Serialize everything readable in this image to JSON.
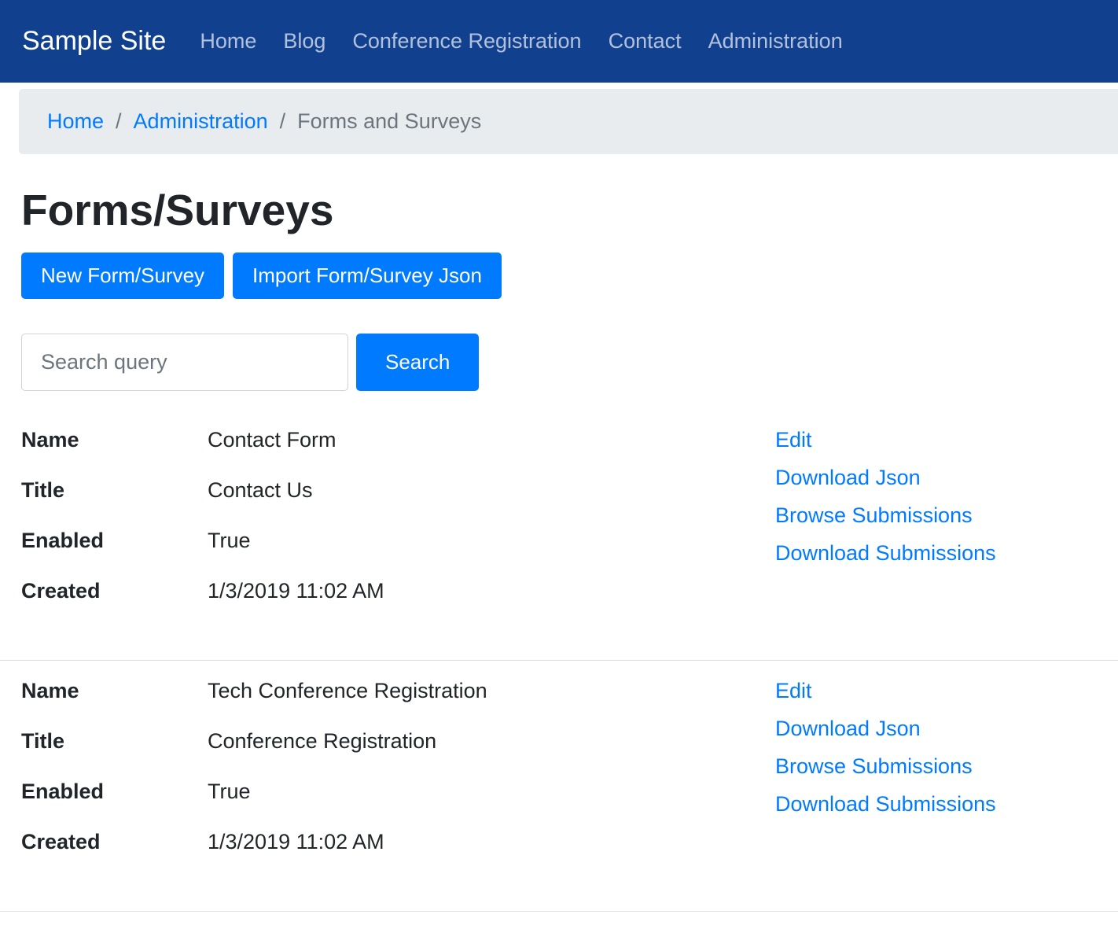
{
  "navbar": {
    "brand": "Sample Site",
    "items": [
      {
        "label": "Home"
      },
      {
        "label": "Blog"
      },
      {
        "label": "Conference Registration"
      },
      {
        "label": "Contact"
      },
      {
        "label": "Administration"
      }
    ]
  },
  "breadcrumb": {
    "separator": "/",
    "items": [
      {
        "label": "Home"
      },
      {
        "label": "Administration"
      },
      {
        "label": "Forms and Surveys"
      }
    ]
  },
  "page": {
    "title": "Forms/Surveys"
  },
  "toolbar": {
    "new_button": "New Form/Survey",
    "import_button": "Import Form/Survey Json"
  },
  "search": {
    "placeholder": "Search query",
    "button": "Search"
  },
  "records": [
    {
      "fields": [
        {
          "label": "Name",
          "value": "Contact Form"
        },
        {
          "label": "Title",
          "value": "Contact Us"
        },
        {
          "label": "Enabled",
          "value": "True"
        },
        {
          "label": "Created",
          "value": "1/3/2019 11:02 AM"
        }
      ],
      "actions": [
        "Edit",
        "Download Json",
        "Browse Submissions",
        "Download Submissions"
      ]
    },
    {
      "fields": [
        {
          "label": "Name",
          "value": "Tech Conference Registration"
        },
        {
          "label": "Title",
          "value": "Conference Registration"
        },
        {
          "label": "Enabled",
          "value": "True"
        },
        {
          "label": "Created",
          "value": "1/3/2019 11:02 AM"
        }
      ],
      "actions": [
        "Edit",
        "Download Json",
        "Browse Submissions",
        "Download Submissions"
      ]
    }
  ],
  "colors": {
    "navbar_bg": "#11408f",
    "link": "#007bff",
    "button_bg": "#007bff",
    "button_text": "#ffffff",
    "breadcrumb_bg": "#e9ecef",
    "muted_text": "#6c757d",
    "body_text": "#212529"
  }
}
